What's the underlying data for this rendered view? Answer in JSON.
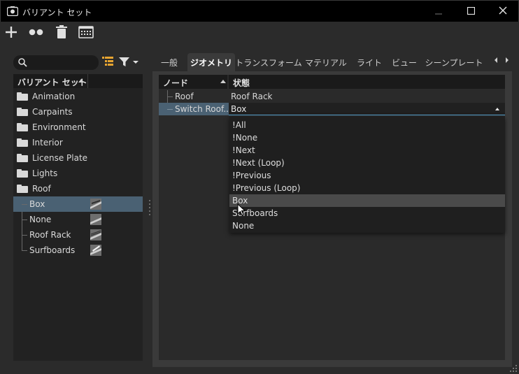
{
  "window": {
    "title": "バリアント セット",
    "icons": {
      "app": "variant-set-app-icon",
      "minimize": "minimize-icon",
      "maximize": "maximize-icon",
      "close": "close-icon"
    }
  },
  "toolbar": {
    "buttons": [
      {
        "icon": "add-icon"
      },
      {
        "icon": "dots-icon"
      },
      {
        "icon": "trash-icon"
      },
      {
        "icon": "calendar-grid-icon"
      }
    ]
  },
  "left": {
    "search": {
      "placeholder": "",
      "icon": "search-icon"
    },
    "tree_header": "バリアント セット",
    "items": [
      {
        "label": "Animation",
        "type": "folder"
      },
      {
        "label": "Carpaints",
        "type": "folder"
      },
      {
        "label": "Environment",
        "type": "folder"
      },
      {
        "label": "Interior",
        "type": "folder"
      },
      {
        "label": "License Plate",
        "type": "folder"
      },
      {
        "label": "Lights",
        "type": "folder"
      },
      {
        "label": "Roof",
        "type": "folder"
      },
      {
        "label": "Box",
        "type": "variant",
        "selected": true
      },
      {
        "label": "None",
        "type": "variant"
      },
      {
        "label": "Roof Rack",
        "type": "variant"
      },
      {
        "label": "Surfboards",
        "type": "variant"
      }
    ]
  },
  "right": {
    "tabs": [
      "一般",
      "ジオメトリ",
      "トランスフォーム",
      "マテリアル",
      "ライト",
      "ビュー",
      "シーンプレート"
    ],
    "active_tab": "ジオメトリ",
    "table": {
      "headers": [
        "ノード",
        "状態"
      ],
      "rows": [
        {
          "node": "Roof",
          "state": "Roof Rack"
        },
        {
          "node": "Switch Roof...",
          "state": "Box"
        }
      ]
    },
    "dropdown": {
      "options": [
        "!All",
        "!None",
        "!Next",
        "!Next (Loop)",
        "!Previous",
        "!Previous (Loop)",
        "Box",
        "Surfboards",
        "None"
      ],
      "hovered": "Box"
    }
  },
  "colors": {
    "titlebar": "#000000",
    "background": "#2b2b2b",
    "selection": "#4a6173",
    "focus_underline": "#5aa9d6"
  }
}
